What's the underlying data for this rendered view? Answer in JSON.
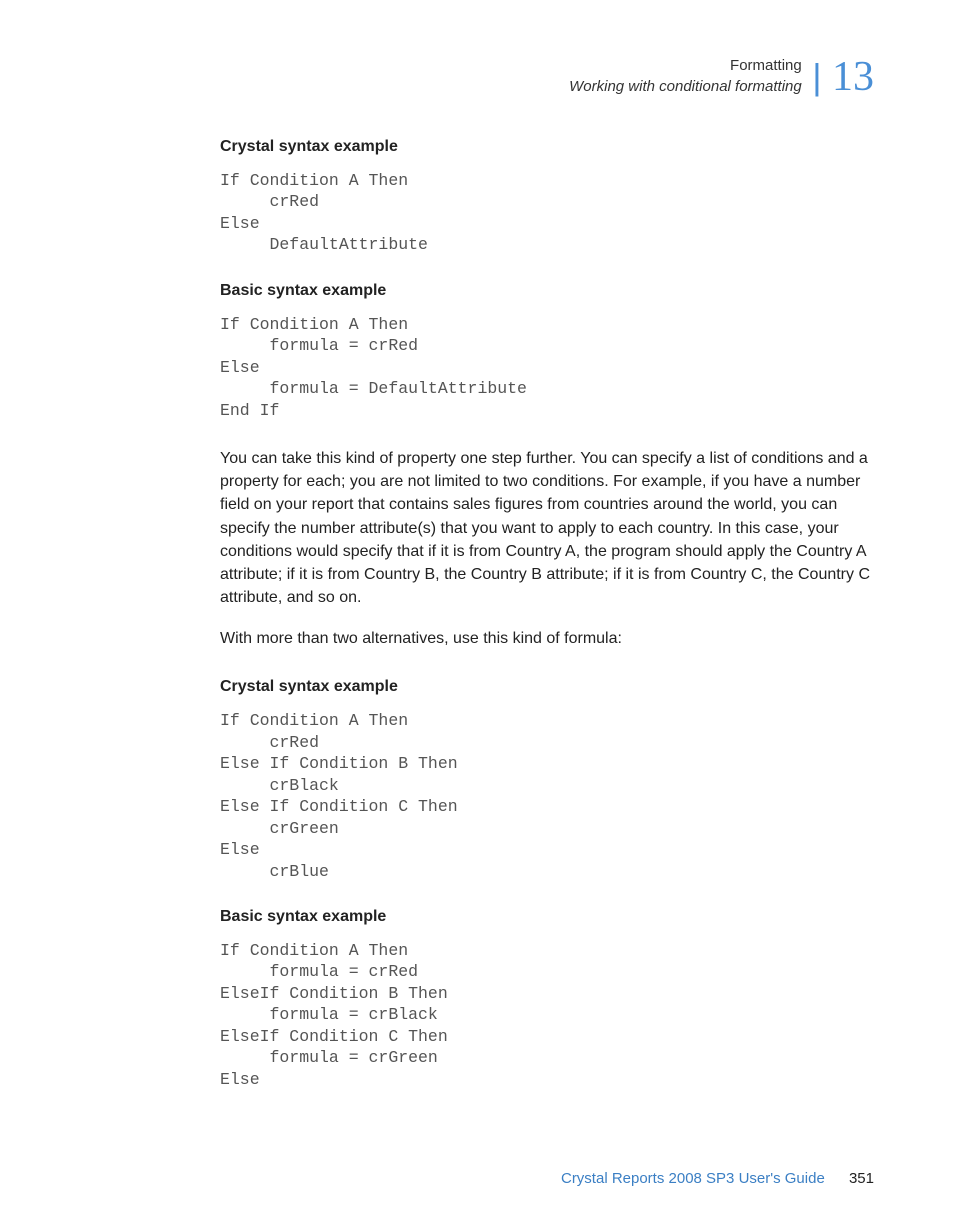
{
  "header": {
    "chapter_title": "Formatting",
    "section_title": "Working with conditional formatting",
    "chapter_number": "13"
  },
  "content": {
    "h1": "Crystal syntax example",
    "code1": "If Condition A Then\n     crRed\nElse\n     DefaultAttribute",
    "h2": "Basic syntax example",
    "code2": "If Condition A Then\n     formula = crRed\nElse\n     formula = DefaultAttribute\nEnd If",
    "para1": "You can take this kind of property one step further. You can specify a list of conditions and a property for each; you are not limited to two conditions. For example, if you have a number field on your report that contains sales figures from countries around the world, you can specify the number attribute(s) that you want to apply to each country. In this case, your conditions would specify that if it is from Country A, the program should apply the Country A attribute; if it is from Country B, the Country B attribute; if it is from Country C, the Country C attribute, and so on.",
    "para2": "With more than two alternatives, use this kind of formula:",
    "h3": "Crystal syntax example",
    "code3": "If Condition A Then\n     crRed\nElse If Condition B Then\n     crBlack\nElse If Condition C Then\n     crGreen\nElse\n     crBlue",
    "h4": "Basic syntax example",
    "code4": "If Condition A Then\n     formula = crRed\nElseIf Condition B Then\n     formula = crBlack\nElseIf Condition C Then\n     formula = crGreen\nElse"
  },
  "footer": {
    "doc_title": "Crystal Reports 2008 SP3 User's Guide",
    "page_number": "351"
  }
}
